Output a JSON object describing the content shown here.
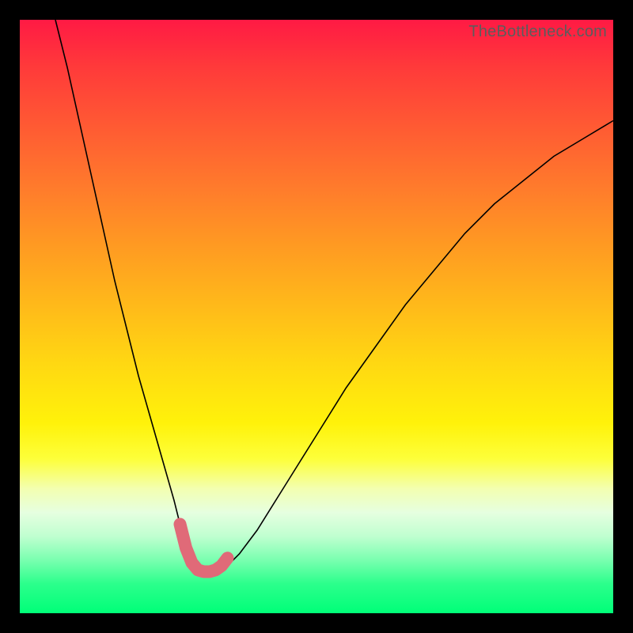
{
  "watermark": "TheBottleneck.com",
  "chart_data": {
    "type": "line",
    "title": "",
    "xlabel": "",
    "ylabel": "",
    "xlim": [
      0,
      100
    ],
    "ylim": [
      0,
      100
    ],
    "grid": false,
    "legend": false,
    "series": [
      {
        "name": "bottleneck-curve",
        "x": [
          6,
          8,
          10,
          12,
          14,
          16,
          18,
          20,
          22,
          24,
          26,
          27,
          28,
          29.5,
          31,
          33,
          35,
          37,
          40,
          45,
          50,
          55,
          60,
          65,
          70,
          75,
          80,
          85,
          90,
          95,
          100
        ],
        "y": [
          100,
          92,
          83,
          74,
          65,
          56,
          48,
          40,
          33,
          26,
          19,
          15,
          11,
          8,
          7,
          7,
          8,
          10,
          14,
          22,
          30,
          38,
          45,
          52,
          58,
          64,
          69,
          73,
          77,
          80,
          83
        ]
      }
    ],
    "highlight": {
      "name": "optimal-range",
      "x": [
        27,
        28,
        29,
        30,
        31,
        32,
        33,
        34,
        35
      ],
      "y": [
        15,
        11,
        8.5,
        7.3,
        7,
        7,
        7.3,
        8,
        9.3
      ]
    },
    "background_gradient": {
      "top_color": "#ff1a44",
      "bottom_color": "#00ff78",
      "meaning": "red=high bottleneck, green=low bottleneck"
    }
  }
}
